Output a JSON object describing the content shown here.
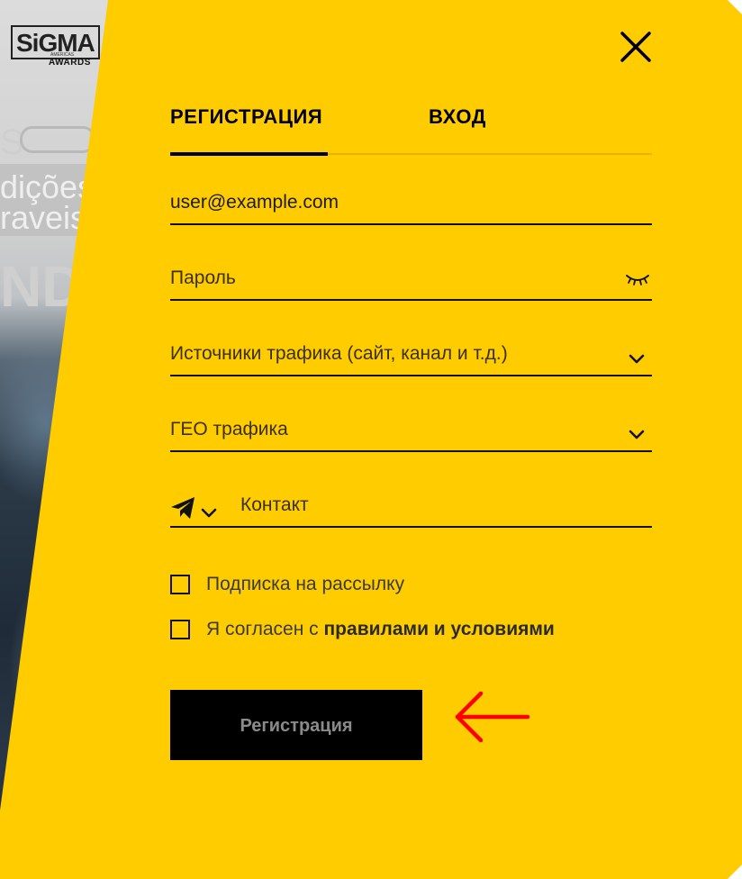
{
  "background": {
    "ghost_line1": "dições",
    "ghost_line2": "raveis",
    "ghost_big": "NDS",
    "ghost_s": "S"
  },
  "logo": {
    "main": "SiGMA",
    "mini": "AMERICAS",
    "sub": "AWARDS"
  },
  "tabs": {
    "register": "РЕГИСТРАЦИЯ",
    "login": "ВХОД",
    "active": "register"
  },
  "form": {
    "email_value": "user@example.com",
    "password_placeholder": "Пароль",
    "traffic_sources_placeholder": "Источники трафика (сайт, канал и т.д.)",
    "geo_placeholder": "ГЕО трафика",
    "contact_placeholder": "Контакт",
    "messenger_icon": "telegram-icon",
    "newsletter_label": "Подписка на рассылку",
    "terms_prefix": "Я согласен с ",
    "terms_link": "правилами и условиями",
    "submit_label": "Регистрация"
  },
  "colors": {
    "modal_bg": "#ffcc00",
    "button_bg": "#000000",
    "button_text": "#8a8a8a",
    "annotation_arrow": "#ff0000"
  }
}
